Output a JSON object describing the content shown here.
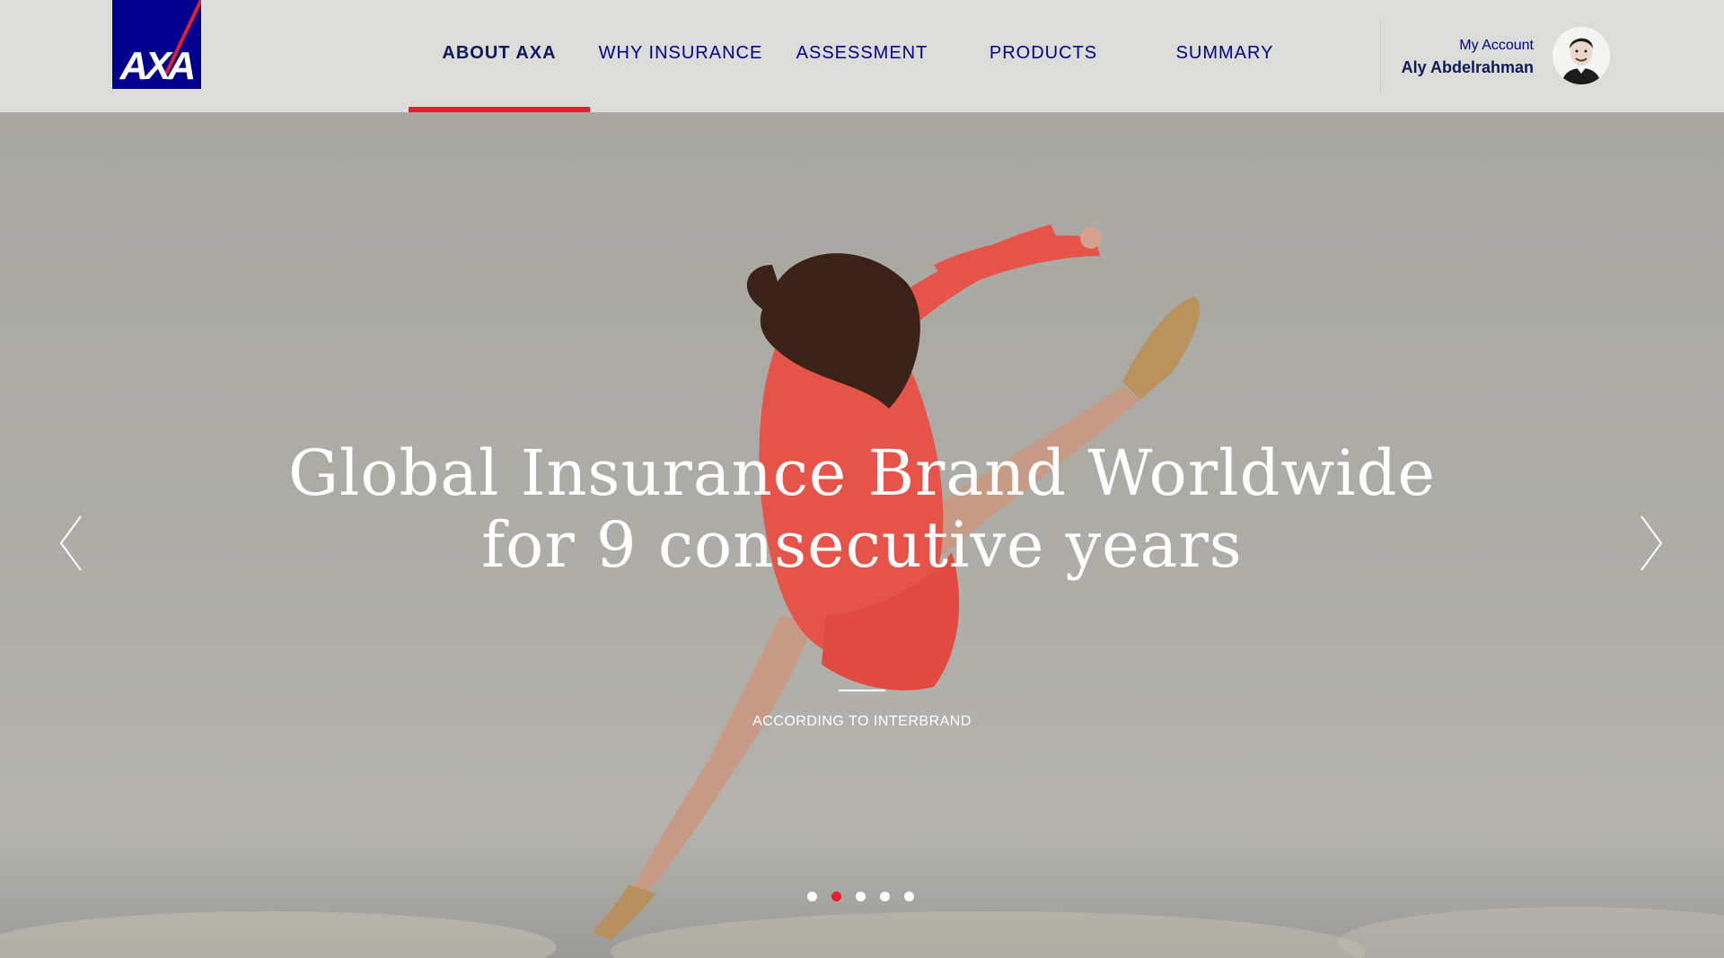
{
  "brand": {
    "logo_text": "AXA",
    "brand_color": "#00008f",
    "accent_color": "#e3202c"
  },
  "nav": {
    "items": [
      {
        "label": "ABOUT AXA",
        "active": true
      },
      {
        "label": "WHY INSURANCE",
        "active": false
      },
      {
        "label": "ASSESSMENT",
        "active": false
      },
      {
        "label": "PRODUCTS",
        "active": false
      },
      {
        "label": "SUMMARY",
        "active": false
      }
    ]
  },
  "account": {
    "label": "My Account",
    "name": "Aly Abdelrahman",
    "avatar_icon": "user-avatar"
  },
  "hero": {
    "headline_line1": "Global Insurance Brand Worldwide",
    "headline_line2": "for 9 consecutive years",
    "source": "ACCORDING TO INTERBRAND",
    "prev_icon": "chevron-left-icon",
    "next_icon": "chevron-right-icon",
    "slides_total": 5,
    "active_slide": 2
  }
}
